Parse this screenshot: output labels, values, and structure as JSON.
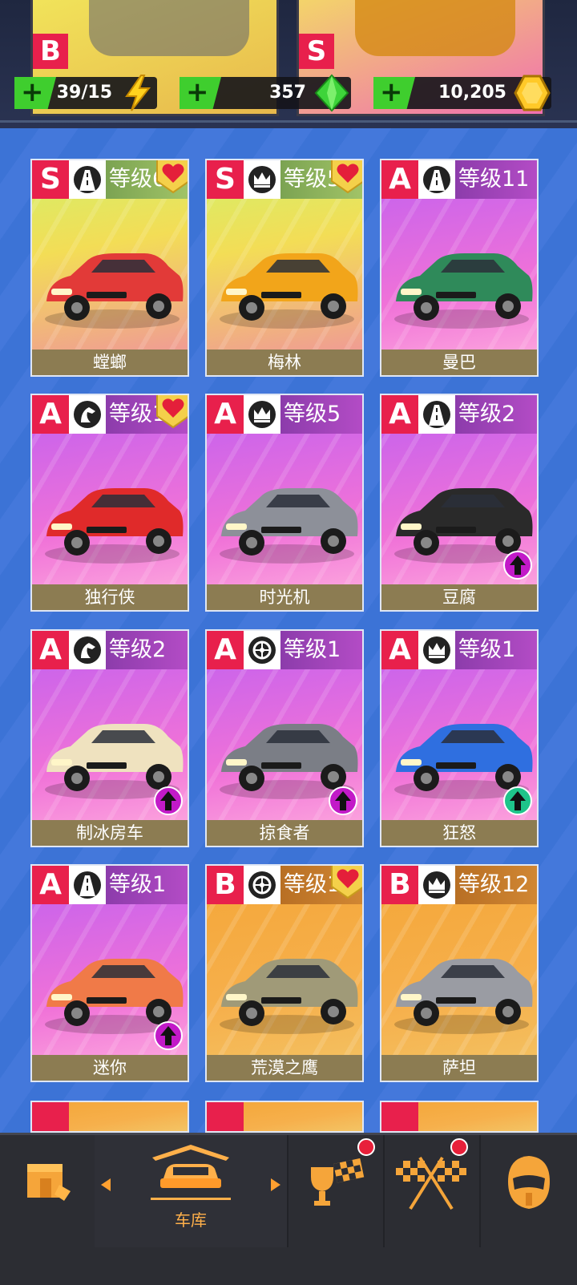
{
  "resources": {
    "fuel": {
      "value": "39/15",
      "icon": "lightning-bolt-icon"
    },
    "gems": {
      "value": "357",
      "icon": "green-gem-icon"
    },
    "coins": {
      "value": "10,205",
      "icon": "gold-coin-icon"
    },
    "add_symbol": "+"
  },
  "top_cards": [
    {
      "class": "B"
    },
    {
      "class": "S"
    }
  ],
  "cars": [
    {
      "name": "螳螂",
      "class": "S",
      "level": "等级6",
      "favorite": true,
      "upgrade": false,
      "trait": "road-icon",
      "color": "#e23a38"
    },
    {
      "name": "梅林",
      "class": "S",
      "level": "等级5",
      "favorite": true,
      "upgrade": false,
      "trait": "crown-icon",
      "color": "#f2a51a"
    },
    {
      "name": "曼巴",
      "class": "A",
      "level": "等级11",
      "favorite": false,
      "upgrade": false,
      "trait": "road-icon",
      "color": "#2f8a5a"
    },
    {
      "name": "独行侠",
      "class": "A",
      "level": "等级1",
      "favorite": true,
      "upgrade": false,
      "trait": "horse-icon",
      "color": "#e02a2a"
    },
    {
      "name": "时光机",
      "class": "A",
      "level": "等级5",
      "favorite": false,
      "upgrade": false,
      "trait": "crown-icon",
      "color": "#8d9099"
    },
    {
      "name": "豆腐",
      "class": "A",
      "level": "等级2",
      "favorite": false,
      "upgrade": true,
      "upgrade_color": "#c21ac8",
      "trait": "road-icon",
      "color": "#2a2a2a"
    },
    {
      "name": "制冰房车",
      "class": "A",
      "level": "等级2",
      "favorite": false,
      "upgrade": true,
      "upgrade_color": "#c21ac8",
      "trait": "horse-icon",
      "color": "#efe2bf"
    },
    {
      "name": "掠食者",
      "class": "A",
      "level": "等级1",
      "favorite": false,
      "upgrade": true,
      "upgrade_color": "#c21ac8",
      "trait": "wheel-icon",
      "color": "#7b7e86"
    },
    {
      "name": "狂怒",
      "class": "A",
      "level": "等级1",
      "favorite": false,
      "upgrade": true,
      "upgrade_color": "#1ec48a",
      "trait": "crown-icon",
      "color": "#2f6fe0"
    },
    {
      "name": "迷你",
      "class": "A",
      "level": "等级1",
      "favorite": false,
      "upgrade": true,
      "upgrade_color": "#c21ac8",
      "trait": "road-icon",
      "color": "#f07a48"
    },
    {
      "name": "荒漠之鹰",
      "class": "B",
      "level": "等级1",
      "favorite": true,
      "upgrade": false,
      "trait": "wheel-icon",
      "color": "#a09a78"
    },
    {
      "name": "萨坦",
      "class": "B",
      "level": "等级12",
      "favorite": false,
      "upgrade": false,
      "trait": "crown-icon",
      "color": "#9a9ca3"
    }
  ],
  "nav": {
    "shop_icon": "shop-icon",
    "garage_label": "车库",
    "garage_icon": "garage-car-icon",
    "trophy_icon": "trophy-flag-icon",
    "race_icon": "checkered-flags-icon",
    "profile_icon": "helmet-icon"
  }
}
